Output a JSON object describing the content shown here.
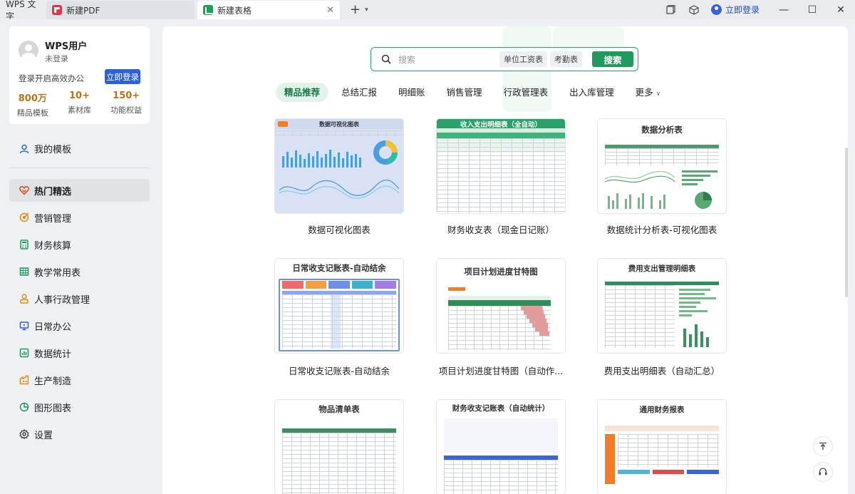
{
  "tabs": [
    {
      "label": "WPS 文字"
    },
    {
      "label": "新建PDF"
    },
    {
      "label": "新建表格"
    }
  ],
  "top_right": {
    "login": "立即登录"
  },
  "user": {
    "name": "WPS用户",
    "status": "未登录",
    "hint": "登录开启高效办公",
    "login_button": "立即登录",
    "stats": [
      {
        "value": "800万",
        "label": "精品模板"
      },
      {
        "value": "10+",
        "label": "素材库"
      },
      {
        "value": "150+",
        "label": "功能权益"
      }
    ]
  },
  "sidebar": {
    "my_templates": "我的模板",
    "items": [
      {
        "label": "热门精选",
        "icon": "heart-icon",
        "color": "#e2471f"
      },
      {
        "label": "营销管理",
        "icon": "target-icon",
        "color": "#e08a12"
      },
      {
        "label": "财务核算",
        "icon": "calculator-icon",
        "color": "#1f9a5c"
      },
      {
        "label": "教学常用表",
        "icon": "table-icon",
        "color": "#1f9a5c"
      },
      {
        "label": "人事行政管理",
        "icon": "person-icon",
        "color": "#e08a12"
      },
      {
        "label": "日常办公",
        "icon": "monitor-icon",
        "color": "#2b61e0"
      },
      {
        "label": "数据统计",
        "icon": "chart-icon",
        "color": "#1f9a5c"
      },
      {
        "label": "生产制造",
        "icon": "factory-icon",
        "color": "#e08a12"
      },
      {
        "label": "图形图表",
        "icon": "pie-icon",
        "color": "#1f9a5c"
      },
      {
        "label": "设置",
        "icon": "gear-icon",
        "color": "#333333"
      }
    ]
  },
  "search": {
    "placeholder": "搜索",
    "chips": [
      "单位工资表",
      "考勤表"
    ],
    "button": "搜索"
  },
  "categories": [
    "精品推荐",
    "总结汇报",
    "明细账",
    "销售管理",
    "行政管理表",
    "出入库管理",
    "更多"
  ],
  "templates": [
    {
      "label": "数据可视化图表",
      "thumb_title": "数据可视化图表"
    },
    {
      "label": "财务收支表（现金日记账）",
      "thumb_title": "收入支出明细表（全自动）"
    },
    {
      "label": "数据统计分析表-可视化图表",
      "thumb_title": "数据分析表"
    },
    {
      "label": "日常收支记账表-自动结余",
      "thumb_title": "日常收支记账表-自动结余"
    },
    {
      "label": "项目计划进度甘特图（自动作...",
      "thumb_title": "项目计划进度甘特图"
    },
    {
      "label": "费用支出明细表（自动汇总）",
      "thumb_title": "费用支出管理明细表"
    },
    {
      "label": "",
      "thumb_title": "物品清单表"
    },
    {
      "label": "",
      "thumb_title": "财务收支记账表（自动统计）"
    },
    {
      "label": "",
      "thumb_title": "通用财务报表"
    }
  ],
  "colors": {
    "accent": "#1f9a5c",
    "brand_blue": "#2b61e0",
    "stat_gold": "#b8741a"
  }
}
